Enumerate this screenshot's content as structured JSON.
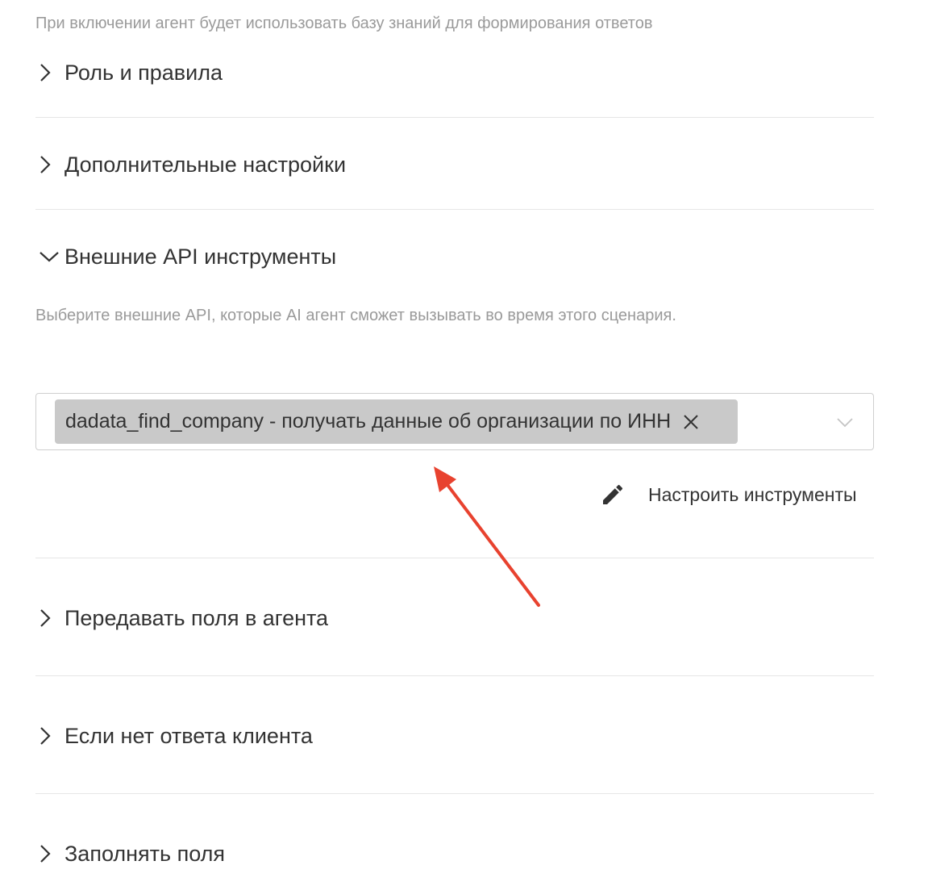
{
  "knowledge_base": {
    "hint": "При включении агент будет использовать базу знаний для формирования ответов"
  },
  "sections": [
    {
      "title": "Роль и правила",
      "expanded": false
    },
    {
      "title": "Дополнительные настройки",
      "expanded": false
    },
    {
      "title": "Внешние API инструменты",
      "expanded": true
    },
    {
      "title": "Передавать поля в агента",
      "expanded": false
    },
    {
      "title": "Если нет ответа клиента",
      "expanded": false
    },
    {
      "title": "Заполнять поля",
      "expanded": false
    }
  ],
  "api_tools": {
    "description": "Выберите внешние API, которые AI агент сможет вызывать во время этого сценария.",
    "selected_tags": [
      {
        "label": "dadata_find_company - получать данные об организации по ИНН"
      }
    ],
    "configure_label": "Настроить инструменты"
  },
  "icons": {
    "collapsed": "chevron-right-icon",
    "expanded": "chevron-down-icon",
    "tag_remove": "close-icon",
    "select_caret": "chevron-down-icon",
    "configure": "pencil-icon"
  },
  "colors": {
    "text": "#333333",
    "muted": "#9a9a9a",
    "divider": "#e6e6e6",
    "tag_bg": "#c9c9c9",
    "annotation_arrow": "#e8422f"
  }
}
